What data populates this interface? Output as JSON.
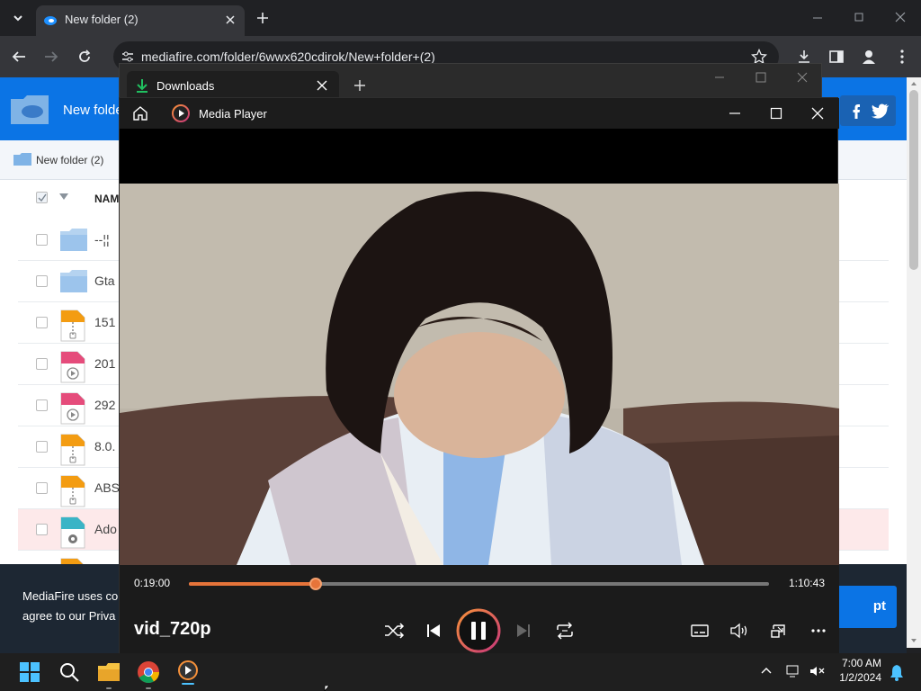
{
  "browser": {
    "tab_title": "New folder (2)",
    "url": "mediafire.com/folder/6wwx620cdirok/New+folder+(2)"
  },
  "page": {
    "header_title": "New folde",
    "breadcrumb": "New folder (2)",
    "column_name": "NAM",
    "rows": [
      {
        "name": "--¦¦",
        "type": "folder"
      },
      {
        "name": "Gta",
        "type": "folder"
      },
      {
        "name": "151",
        "type": "zip"
      },
      {
        "name": "201",
        "type": "video"
      },
      {
        "name": "292",
        "type": "video"
      },
      {
        "name": "8.0.",
        "type": "zip"
      },
      {
        "name": "ABS",
        "type": "zip"
      },
      {
        "name": "Ado",
        "type": "exe"
      }
    ],
    "cookie_line1": "MediaFire uses co",
    "cookie_line2": "agree to our Priva",
    "accept_label": "pt"
  },
  "downloads": {
    "tab_title": "Downloads"
  },
  "player": {
    "app_title": "Media Player",
    "current_time": "0:19:00",
    "total_time": "1:10:43",
    "progress": 0.219,
    "video_title": "vid_720p"
  },
  "taskbar": {
    "time": "7:00 AM",
    "date": "1/2/2024"
  },
  "colors": {
    "accent": "#e6743a",
    "mediafire_blue": "#0b74e5"
  }
}
